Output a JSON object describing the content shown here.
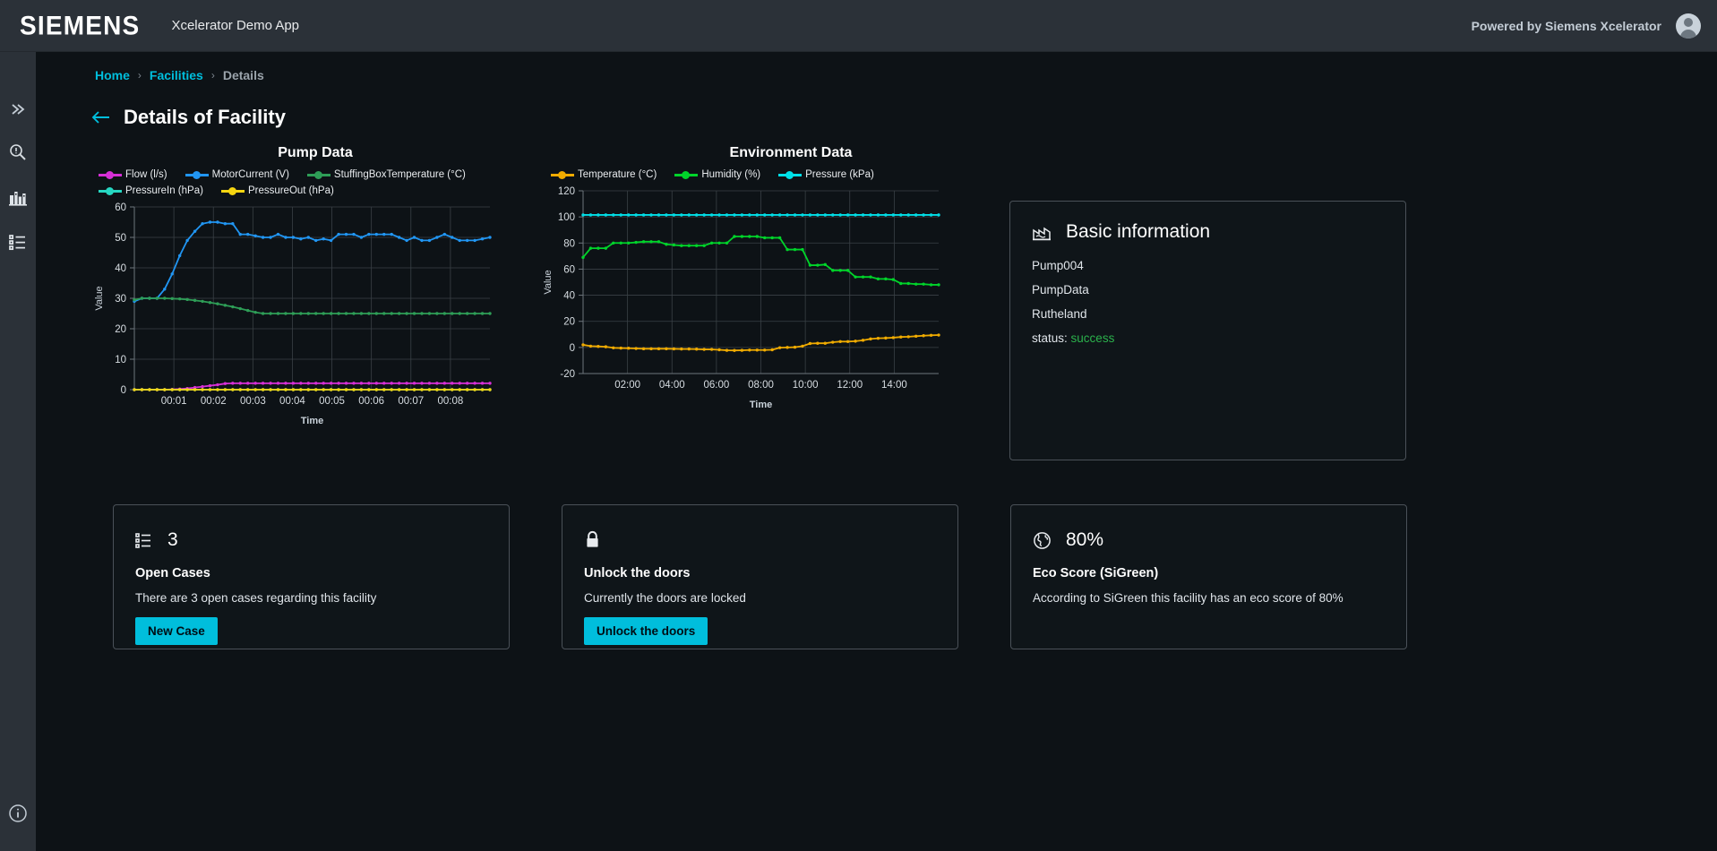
{
  "header": {
    "logo": "SIEMENS",
    "app_title": "Xcelerator Demo App",
    "powered_by": "Powered by Siemens Xcelerator",
    "avatar_icon": "user-avatar-icon"
  },
  "sidebar": {
    "items": [
      {
        "icon": "double-chevron-right-icon",
        "name": "expand-sidebar"
      },
      {
        "icon": "search-alert-icon",
        "name": "search"
      },
      {
        "icon": "factory-icon",
        "name": "facilities"
      },
      {
        "icon": "list-icon",
        "name": "cases"
      }
    ],
    "bottom": {
      "icon": "info-circle-icon",
      "name": "about"
    }
  },
  "breadcrumb": {
    "items": [
      {
        "label": "Home",
        "current": false
      },
      {
        "label": "Facilities",
        "current": false
      },
      {
        "label": "Details",
        "current": true
      }
    ],
    "separator": "›"
  },
  "page": {
    "back_icon": "arrow-left-icon",
    "title": "Details of Facility"
  },
  "chart_data": [
    {
      "type": "line",
      "title": "Pump Data",
      "xlabel": "Time",
      "ylabel": "Value",
      "ylim": [
        0,
        60
      ],
      "yticks": [
        0,
        10,
        20,
        30,
        40,
        50,
        60
      ],
      "xticks": [
        "00:01",
        "00:02",
        "00:03",
        "00:04",
        "00:05",
        "00:06",
        "00:07",
        "00:08"
      ],
      "grid": true,
      "legend_position": "top",
      "series": [
        {
          "name": "Flow (l/s)",
          "color": "#d62fd6",
          "values": [
            0,
            0,
            0,
            0,
            0,
            0.1,
            0.2,
            0.4,
            0.7,
            1.0,
            1.3,
            1.6,
            2.0,
            2.1,
            2.1,
            2.1,
            2.1,
            2.1,
            2.1,
            2.1,
            2.1,
            2.1,
            2.1,
            2.1,
            2.1,
            2.1,
            2.1,
            2.1,
            2.1,
            2.1,
            2.1,
            2.1,
            2.1,
            2.1,
            2.1,
            2.1,
            2.1,
            2.1,
            2.1,
            2.1,
            2.1,
            2.1,
            2.1,
            2.1,
            2.1,
            2.1,
            2.1,
            2.1
          ]
        },
        {
          "name": "MotorCurrent (V)",
          "color": "#2196f3",
          "values": [
            29,
            30,
            30,
            30,
            33,
            38,
            44,
            49,
            52,
            54.5,
            55,
            55,
            54.5,
            54.5,
            51,
            51,
            50.5,
            50,
            50,
            51,
            50,
            50,
            49.5,
            50,
            49,
            49.5,
            49,
            51,
            51,
            51,
            50,
            51,
            51,
            51,
            51,
            50,
            49,
            50,
            49,
            49,
            50,
            51,
            50,
            49,
            49,
            49,
            49.5,
            50
          ]
        },
        {
          "name": "StuffingBoxTemperature (°C)",
          "color": "#2e9e57",
          "values": [
            29.5,
            30,
            30,
            30,
            30,
            29.9,
            29.8,
            29.6,
            29.3,
            29,
            28.6,
            28.2,
            27.7,
            27.2,
            26.6,
            26,
            25.4,
            25,
            25,
            25,
            25,
            25,
            25,
            25,
            25,
            25,
            25,
            25,
            25,
            25,
            25,
            25,
            25,
            25,
            25,
            25,
            25,
            25,
            25,
            25,
            25,
            25,
            25,
            25,
            25,
            25,
            25,
            25
          ]
        },
        {
          "name": "PressureIn (hPa)",
          "color": "#26d7c2",
          "values": [
            0,
            0,
            0,
            0,
            0,
            0,
            0,
            0,
            0,
            0,
            0,
            0,
            0,
            0,
            0,
            0,
            0,
            0,
            0,
            0,
            0,
            0,
            0,
            0,
            0,
            0,
            0,
            0,
            0,
            0,
            0,
            0,
            0,
            0,
            0,
            0,
            0,
            0,
            0,
            0,
            0,
            0,
            0,
            0,
            0,
            0,
            0,
            0
          ]
        },
        {
          "name": "PressureOut (hPa)",
          "color": "#f5d511",
          "values": [
            0,
            0,
            0,
            0,
            0,
            0,
            0,
            0,
            0,
            0,
            0,
            0,
            0,
            0,
            0,
            0,
            0,
            0,
            0,
            0,
            0,
            0,
            0,
            0,
            0,
            0,
            0,
            0,
            0,
            0,
            0,
            0,
            0,
            0,
            0,
            0,
            0,
            0,
            0,
            0,
            0,
            0,
            0,
            0,
            0,
            0,
            0,
            0
          ]
        }
      ]
    },
    {
      "type": "line",
      "title": "Environment Data",
      "xlabel": "Time",
      "ylabel": "Value",
      "ylim": [
        -20,
        120
      ],
      "yticks": [
        -20,
        0,
        20,
        40,
        60,
        80,
        100,
        120
      ],
      "xticks": [
        "02:00",
        "04:00",
        "06:00",
        "08:00",
        "10:00",
        "12:00",
        "14:00"
      ],
      "grid": true,
      "legend_position": "top",
      "series": [
        {
          "name": "Temperature (°C)",
          "color": "#f0ab00",
          "values": [
            2,
            1,
            0.8,
            0.5,
            -0.3,
            -0.5,
            -0.6,
            -0.8,
            -1,
            -1,
            -1,
            -1,
            -1.1,
            -1.2,
            -1.2,
            -1.3,
            -1.5,
            -1.5,
            -1.8,
            -2.2,
            -2.3,
            -2.2,
            -2,
            -2,
            -2,
            -1.8,
            -0.2,
            0,
            0.2,
            1,
            3,
            3.2,
            3.2,
            4,
            4.5,
            4.5,
            4.8,
            5.5,
            6.5,
            7,
            7.2,
            7.5,
            8,
            8.2,
            8.6,
            9,
            9.3,
            9.5
          ]
        },
        {
          "name": "Humidity (%)",
          "color": "#00d42a",
          "values": [
            69,
            76,
            76,
            76,
            80,
            80,
            80,
            80.5,
            81,
            81,
            81,
            79,
            78.5,
            78,
            78,
            78,
            78,
            80,
            80,
            80,
            85,
            85,
            85,
            85,
            84,
            84,
            84,
            75,
            75,
            75,
            63,
            63,
            63.5,
            59,
            59,
            59,
            54,
            54,
            54,
            52.5,
            52.5,
            52,
            49,
            49,
            48.5,
            48.5,
            48,
            48
          ]
        },
        {
          "name": "Pressure (kPa)",
          "color": "#00e0e8",
          "values": [
            101.5,
            101.5,
            101.5,
            101.5,
            101.5,
            101.5,
            101.5,
            101.5,
            101.5,
            101.5,
            101.5,
            101.5,
            101.5,
            101.5,
            101.5,
            101.5,
            101.5,
            101.5,
            101.5,
            101.5,
            101.5,
            101.5,
            101.5,
            101.5,
            101.5,
            101.5,
            101.5,
            101.5,
            101.5,
            101.5,
            101.5,
            101.5,
            101.5,
            101.5,
            101.5,
            101.5,
            101.5,
            101.5,
            101.5,
            101.5,
            101.5,
            101.5,
            101.5,
            101.5,
            101.5,
            101.5,
            101.5,
            101.5
          ]
        }
      ]
    }
  ],
  "basic_information": {
    "icon": "factory-chart-icon",
    "title": "Basic information",
    "line1": "Pump004",
    "line2": "PumpData",
    "line3": "Rutheland",
    "status_label": "status:",
    "status_value": "success",
    "status_color": "#2bb24c"
  },
  "tiles": [
    {
      "icon": "list-icon",
      "value": "3",
      "title": "Open Cases",
      "description": "There are 3 open cases regarding this facility",
      "button": "New Case"
    },
    {
      "icon": "lock-closed-icon",
      "value": "",
      "title": "Unlock the doors",
      "description": "Currently the doors are locked",
      "button": "Unlock the doors"
    },
    {
      "icon": "globe-icon",
      "value": "80%",
      "title": "Eco Score (SiGreen)",
      "description": "According to SiGreen this facility has an eco score of 80%",
      "button": ""
    }
  ],
  "theme": {
    "accent": "#00bedc",
    "background": "#0d1216",
    "topbar": "#2b3138",
    "card_border": "#4a5158"
  }
}
